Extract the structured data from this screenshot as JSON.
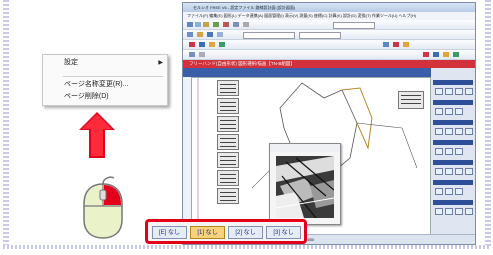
{
  "context_menu": {
    "items": [
      {
        "label": "設定",
        "has_submenu": true
      },
      {
        "label": "ページ名称変更(R)..."
      },
      {
        "label": "ページ削除(D)"
      }
    ]
  },
  "app": {
    "title": "セルシオ FREE V6 - 設定ファイル 路線設計図 (設計図面)",
    "menu": "ファイル(F)  編集(E)  図形(L)  データ連携(A)  図面管理(I)  表示(V)  測量(S)  座標(C)  計算(K)  設計(D)  変換(T)  作業ツール(U)  ヘルプ(H)",
    "red_bar_text": "フリーハンド(自由形状)  図形選択/描画【TN-B組図】",
    "status_text": "X=  Y=  倍率 1:500"
  },
  "page_tabs": [
    {
      "label": "[E] なし",
      "active": false
    },
    {
      "label": "[1] なし",
      "active": true
    },
    {
      "label": "[2] なし",
      "active": false
    },
    {
      "label": "[3] なし",
      "active": false
    }
  ],
  "colors": {
    "highlight": "#e3001b",
    "arrow": "#e3001b",
    "app_header_red": "#d2303a",
    "toolbar_blue": "#3b5ea8",
    "mouse_body": "#e9f2c8",
    "mouse_button": "#e3001b"
  }
}
